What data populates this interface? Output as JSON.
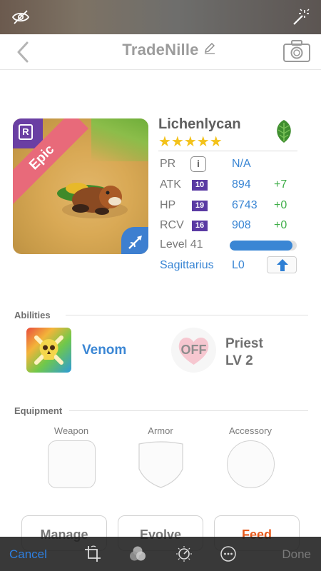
{
  "nav": {
    "title": "TradeNille"
  },
  "card": {
    "rarity": "Epic",
    "rarity_badge": "R",
    "ribbon_color": "#e86a7a",
    "badge_color": "#6a3fa3",
    "class_badge_color": "#3d7fd0"
  },
  "monster": {
    "name": "Lichenlycan",
    "stars": "★★★★★",
    "element_icon": "leaf-icon",
    "element_color": "#3f8e2f"
  },
  "stats": [
    {
      "label": "PR",
      "badge": "",
      "value": "N/A",
      "bonus": ""
    },
    {
      "label": "ATK",
      "badge": "10",
      "value": "894",
      "bonus": "+7"
    },
    {
      "label": "HP",
      "badge": "19",
      "value": "6743",
      "bonus": "+0"
    },
    {
      "label": "RCV",
      "badge": "16",
      "value": "908",
      "bonus": "+0"
    }
  ],
  "info_glyph": "i",
  "level": {
    "label": "Level 41",
    "progress": 0.94
  },
  "sign": {
    "name": "Sagittarius",
    "level": "L0"
  },
  "abilities": {
    "title": "Abilities",
    "active": {
      "name": "Venom"
    },
    "passive": {
      "badge": "OFF",
      "name": "Priest",
      "level": "LV 2"
    }
  },
  "equipment": {
    "title": "Equipment",
    "slots": [
      "Weapon",
      "Armor",
      "Accessory"
    ]
  },
  "actions": [
    "Manage",
    "Evolve",
    "Feed"
  ],
  "editor": {
    "cancel": "Cancel",
    "done": "Done"
  },
  "colors": {
    "accent": "#3a86d4",
    "green": "#3fae49",
    "star": "#f3c21a",
    "level_badge": "#5a3aa3"
  }
}
